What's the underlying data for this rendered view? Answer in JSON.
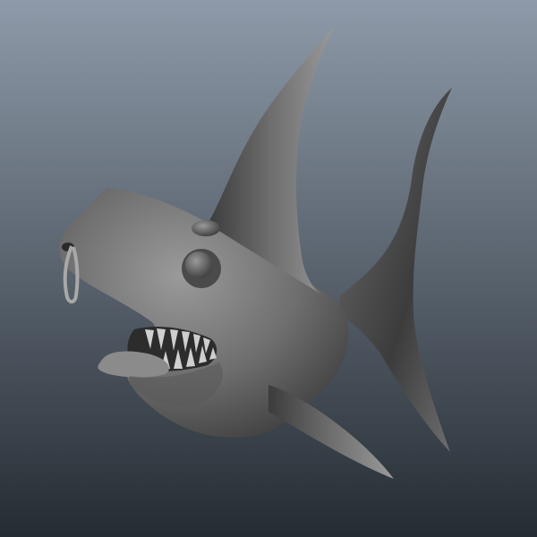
{
  "scene": {
    "subject": "shark-model",
    "background_top": "#8e9aa9",
    "background_bottom": "#252c33",
    "body_light": "#9a9a9a",
    "body_mid": "#6e6e6e",
    "body_dark": "#3c3c3c",
    "tongue": "#8b8b8b",
    "teeth": "#cfcfcf",
    "mouth_interior": "#2c2c2c",
    "nose_ring": "#a8a8a8"
  }
}
